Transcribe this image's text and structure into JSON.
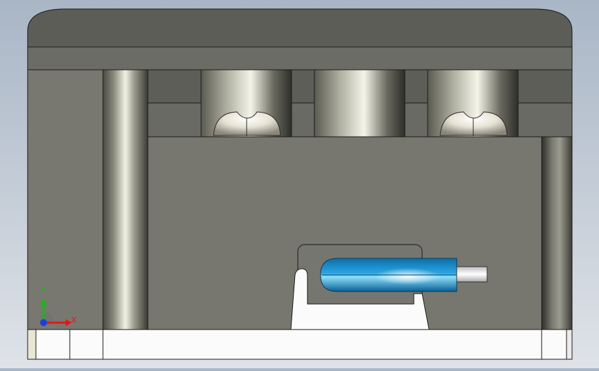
{
  "viewport": {
    "background": [
      "#a9b6c6",
      "#dfe3e8"
    ],
    "model_colors": {
      "housing": "#787870",
      "housing_dark": "#5c5d57",
      "housing_mid": "#6c6c66",
      "base": "#fbfbfb",
      "edge": "#1a1a1a",
      "handle_blue": "#1190d8",
      "pin": "#e6e6e6"
    }
  },
  "triad": {
    "x_label": "X",
    "y_label": "Y",
    "x_color": "#e01818",
    "y_color": "#18b818",
    "z_color": "#1840e0"
  }
}
